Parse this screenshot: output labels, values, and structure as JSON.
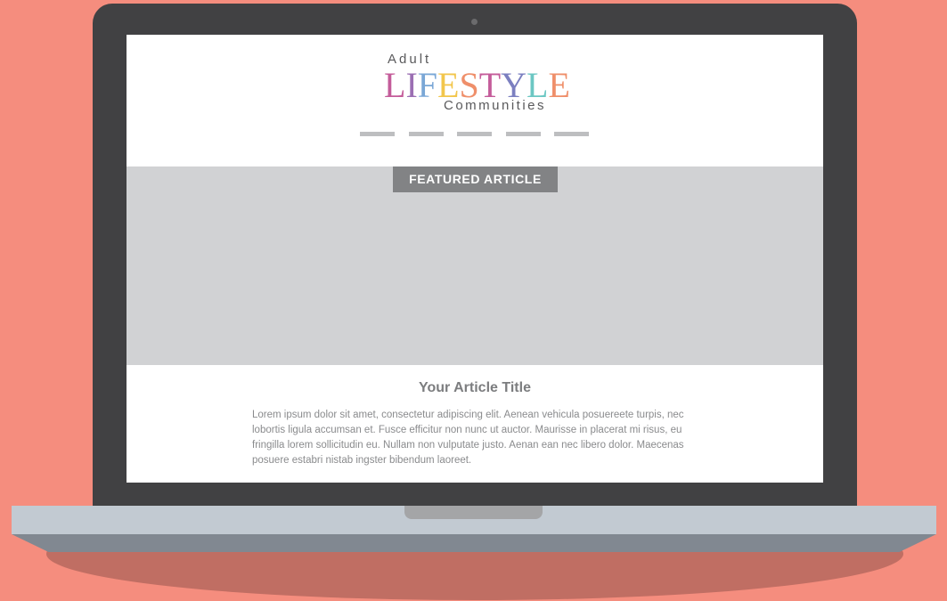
{
  "logo": {
    "top_word": "Adult",
    "main_word_letters": [
      {
        "char": "L",
        "color": "#c45c9a"
      },
      {
        "char": "I",
        "color": "#9b6fb3"
      },
      {
        "char": "F",
        "color": "#7aa7d6"
      },
      {
        "char": "E",
        "color": "#f2c64c"
      },
      {
        "char": "S",
        "color": "#ef8f6a"
      },
      {
        "char": "T",
        "color": "#c45c9a"
      },
      {
        "char": "Y",
        "color": "#7b7fc0"
      },
      {
        "char": "L",
        "color": "#6cc7c3"
      },
      {
        "char": "E",
        "color": "#ef8f6a"
      }
    ],
    "bottom_word": "Communities"
  },
  "nav": {
    "item_count": 5
  },
  "hero": {
    "badge_label": "FEATURED ARTICLE"
  },
  "article": {
    "title": "Your Article Title",
    "body": "Lorem ipsum dolor sit amet, consectetur adipiscing elit. Aenean vehicula posuereete turpis, nec lobortis ligula accumsan et. Fusce efficitur non nunc ut auctor. Maurisse in placerat mi risus, eu fringilla lorem sollicitudin eu. Nullam non vulputate justo. Aenan ean nec libero dolor. Maecenas posuere estabri nistab ingster bibendum laoreet."
  },
  "colors": {
    "background": "#f58d7e",
    "laptop_bezel": "#414143",
    "hero_placeholder": "#d1d2d4",
    "badge": "#828385"
  }
}
